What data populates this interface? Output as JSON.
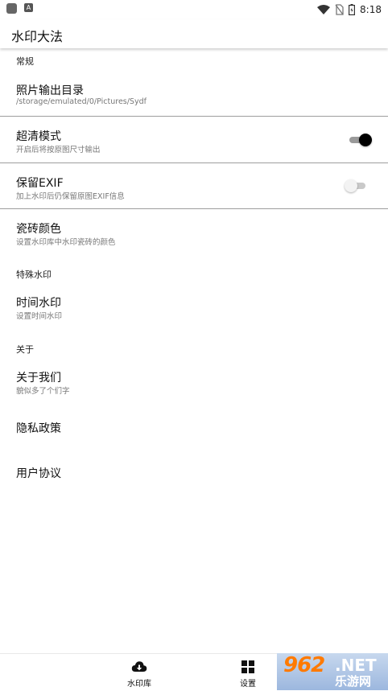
{
  "status_bar": {
    "app_icon_2_label": "A",
    "time": "8:18"
  },
  "app_bar": {
    "title": "水印大法"
  },
  "settings": {
    "categories": {
      "general": "常规",
      "special": "特殊水印",
      "about": "关于"
    },
    "items": {
      "photo_dir": {
        "title": "照片输出目录",
        "summary": "/storage/emulated/0/Pictures/Sydf"
      },
      "hd_mode": {
        "title": "超清模式",
        "summary": "开启后将按原图尺寸输出",
        "enabled": true
      },
      "keep_exif": {
        "title": "保留EXIF",
        "summary": "加上水印后仍保留原图EXIF信息",
        "enabled": false
      },
      "tile_color": {
        "title": "瓷砖颜色",
        "summary": "设置水印库中水印瓷砖的颜色"
      },
      "time_watermark": {
        "title": "时间水印",
        "summary": "设置时间水印"
      },
      "about_us": {
        "title": "关于我们",
        "summary": "貌似多了个们字"
      },
      "privacy": {
        "title": "隐私政策"
      },
      "user_agreement": {
        "title": "用户协议"
      }
    }
  },
  "bottom_nav": {
    "tabs": [
      {
        "label": "水印库",
        "icon": "cloud-download-icon"
      },
      {
        "label": "设置",
        "icon": "grid-icon"
      }
    ]
  },
  "watermark": {
    "big": "962",
    "net": ".NET",
    "cn": "乐游网"
  }
}
